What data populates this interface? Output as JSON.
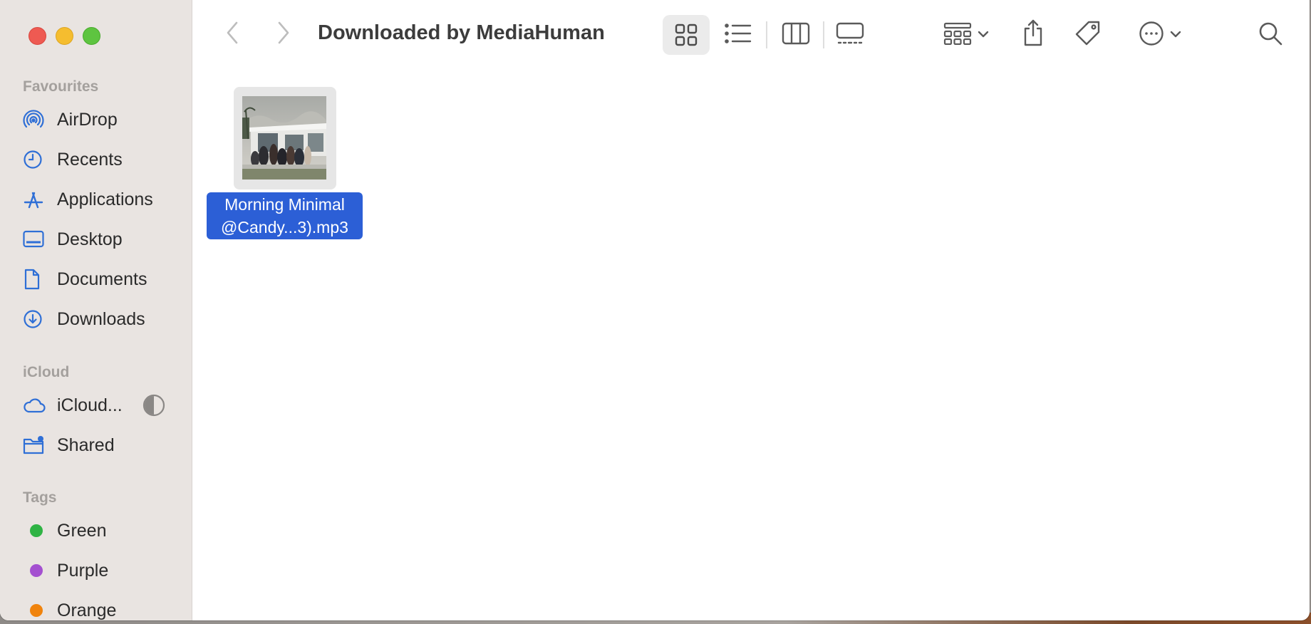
{
  "window": {
    "title": "Downloaded by MediaHuman"
  },
  "sidebar": {
    "favourites_title": "Favourites",
    "favourites": [
      {
        "label": "AirDrop",
        "icon": "airdrop-icon"
      },
      {
        "label": "Recents",
        "icon": "clock-icon"
      },
      {
        "label": "Applications",
        "icon": "applications-icon"
      },
      {
        "label": "Desktop",
        "icon": "desktop-icon"
      },
      {
        "label": "Documents",
        "icon": "document-icon"
      },
      {
        "label": "Downloads",
        "icon": "download-icon"
      }
    ],
    "icloud_title": "iCloud",
    "icloud": [
      {
        "label": "iCloud...",
        "icon": "cloud-icon"
      },
      {
        "label": "Shared",
        "icon": "shared-folder-icon"
      }
    ],
    "tags_title": "Tags",
    "tags": [
      {
        "label": "Green",
        "color": "#2fb344"
      },
      {
        "label": "Purple",
        "color": "#a450d0"
      },
      {
        "label": "Orange",
        "color": "#f0830c"
      }
    ]
  },
  "files": [
    {
      "name": "Morning Minimal @Candy...3).mp3",
      "line1": "Morning Minimal",
      "line2": "@Candy...3).mp3",
      "selected": true
    }
  ],
  "colors": {
    "accent": "#2c5fd6",
    "sidebar_icon": "#2f6fd6"
  }
}
